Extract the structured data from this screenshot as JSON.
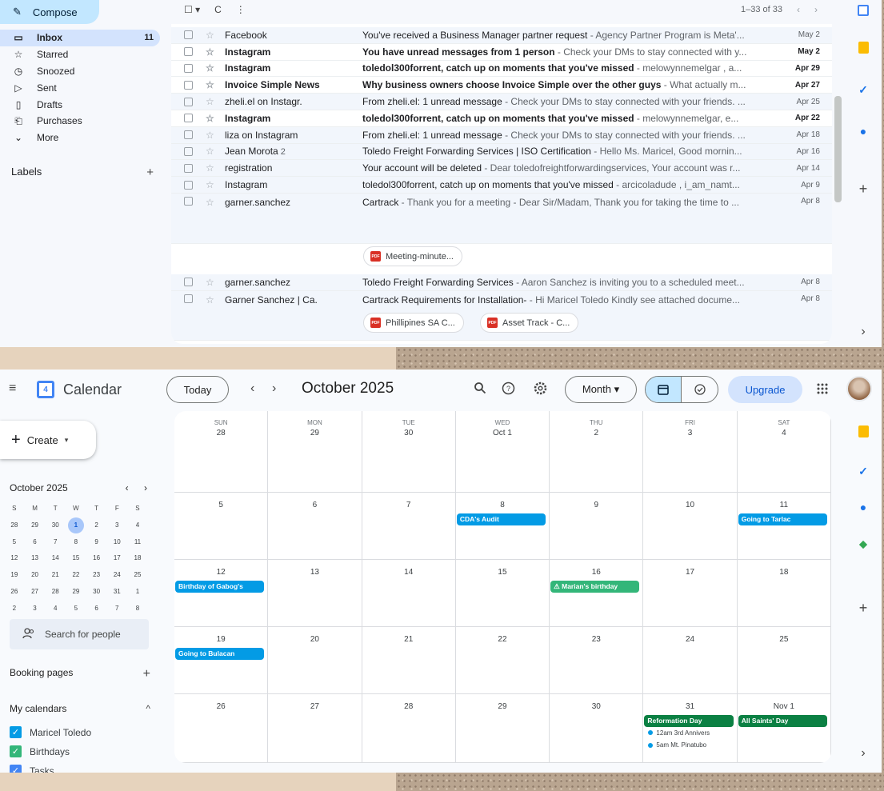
{
  "gmail": {
    "compose_label": "Compose",
    "nav": [
      {
        "icon": "inbox-icon",
        "glyph": "▭",
        "label": "Inbox",
        "count": "11",
        "active": true
      },
      {
        "icon": "star-icon",
        "glyph": "☆",
        "label": "Starred",
        "count": ""
      },
      {
        "icon": "clock-icon",
        "glyph": "◷",
        "label": "Snoozed",
        "count": ""
      },
      {
        "icon": "send-icon",
        "glyph": "▷",
        "label": "Sent",
        "count": ""
      },
      {
        "icon": "draft-icon",
        "glyph": "▯",
        "label": "Drafts",
        "count": ""
      },
      {
        "icon": "purchases-icon",
        "glyph": "⎗",
        "label": "Purchases",
        "count": ""
      },
      {
        "icon": "chevron-down-icon",
        "glyph": "⌄",
        "label": "More",
        "count": ""
      }
    ],
    "labels_title": "Labels",
    "labels_add": "+",
    "toolbar": {
      "select": "☐ ▾",
      "refresh": "C",
      "more": "⋮",
      "range": "1–33 of 33",
      "prev": "‹",
      "next": "›"
    },
    "emails": [
      {
        "sender": "Facebook",
        "num": "",
        "subject": "You've received a Business Manager partner request",
        "snippet": " - Agency Partner Program is Meta'...",
        "date": "May 2",
        "unread": false
      },
      {
        "sender": "Instagram",
        "num": "",
        "subject": "You have unread messages from 1 person",
        "snippet": " - Check your DMs to stay connected with y...",
        "date": "May 2",
        "unread": true
      },
      {
        "sender": "Instagram",
        "num": "",
        "subject": "toledol300forrent, catch up on moments that you've missed",
        "snippet": " - melowynnemelgar , a...",
        "date": "Apr 29",
        "unread": true
      },
      {
        "sender": "Invoice Simple News",
        "num": "",
        "subject": "Why business owners choose Invoice Simple over the other guys",
        "snippet": " - What actually m...",
        "date": "Apr 27",
        "unread": true
      },
      {
        "sender": "zheli.el on Instagr.",
        "num": "",
        "subject": "From zheli.el: 1 unread message",
        "snippet": " - Check your DMs to stay connected with your friends. ...",
        "date": "Apr 25",
        "unread": false
      },
      {
        "sender": "Instagram",
        "num": "",
        "subject": "toledol300forrent, catch up on moments that you've missed",
        "snippet": " - melowynnemelgar, e...",
        "date": "Apr 22",
        "unread": true
      },
      {
        "sender": "liza on Instagram",
        "num": "",
        "subject": "From zheli.el: 1 unread message",
        "snippet": " - Check your DMs to stay connected with your friends. ...",
        "date": "Apr 18",
        "unread": false
      },
      {
        "sender": "Jean Morota",
        "num": " 2",
        "subject": "Toledo Freight Forwarding Services | ISO Certification",
        "snippet": " - Hello Ms. Maricel, Good mornin...",
        "date": "Apr 16",
        "unread": false
      },
      {
        "sender": "registration",
        "num": "",
        "subject": "Your account will be deleted",
        "snippet": " - Dear toledofreightforwardingservices, Your account was r...",
        "date": "Apr 14",
        "unread": false
      },
      {
        "sender": "Instagram",
        "num": "",
        "subject": "toledol300forrent, catch up on moments that you've missed",
        "snippet": " - arcicoladude , i_am_namt...",
        "date": "Apr 9",
        "unread": false
      },
      {
        "sender": "garner.sanchez",
        "num": "",
        "subject": "Cartrack",
        "snippet": " - Thank you for a meeting - Dear Sir/Madam, Thank you for taking the time to ...",
        "date": "Apr 8",
        "unread": false
      },
      {
        "sender": "garner.sanchez",
        "num": "",
        "subject": "Toledo Freight Forwarding Services",
        "snippet": " - Aaron Sanchez is inviting you to a scheduled meet...",
        "date": "Apr 8",
        "unread": false
      },
      {
        "sender": "Garner Sanchez | Ca.",
        "num": "",
        "subject": "Cartrack Requirements for Installation-",
        "snippet": " - Hi Maricel Toledo Kindly see attached docume...",
        "date": "Apr 8",
        "unread": false
      }
    ],
    "attachments": {
      "meeting": "Meeting-minute...",
      "philippines": "Phillipines SA C...",
      "asset": "Asset Track - C..."
    },
    "pdf_badge": "PDF",
    "side_add": "+",
    "side_expand": "›"
  },
  "calendar": {
    "menu_glyph": "≡",
    "logo_day": "4",
    "app_title": "Calendar",
    "today_label": "Today",
    "prev": "‹",
    "next": "›",
    "month_title": "October 2025",
    "view_label": "Month ▾",
    "upgrade_label": "Upgrade",
    "apps_glyph": "⋮⋮⋮",
    "create_label": "Create",
    "mini": {
      "title": "October 2025",
      "prev": "‹",
      "next": "›",
      "dows": [
        "S",
        "M",
        "T",
        "W",
        "T",
        "F",
        "S"
      ],
      "weeks": [
        [
          "28",
          "29",
          "30",
          "1",
          "2",
          "3",
          "4"
        ],
        [
          "5",
          "6",
          "7",
          "8",
          "9",
          "10",
          "11"
        ],
        [
          "12",
          "13",
          "14",
          "15",
          "16",
          "17",
          "18"
        ],
        [
          "19",
          "20",
          "21",
          "22",
          "23",
          "24",
          "25"
        ],
        [
          "26",
          "27",
          "28",
          "29",
          "30",
          "31",
          "1"
        ],
        [
          "2",
          "3",
          "4",
          "5",
          "6",
          "7",
          "8"
        ]
      ],
      "today": "1"
    },
    "search_people": "Search for people",
    "booking_pages": "Booking pages",
    "booking_add": "+",
    "my_calendars": "My calendars",
    "my_calendars_toggle": "^",
    "calendars": [
      {
        "label": "Maricel Toledo",
        "color": "#039be5"
      },
      {
        "label": "Birthdays",
        "color": "#33b679"
      },
      {
        "label": "Tasks",
        "color": "#4285f4"
      }
    ],
    "dows": [
      "SUN",
      "MON",
      "TUE",
      "WED",
      "THU",
      "FRI",
      "SAT"
    ],
    "weeks": [
      [
        "28",
        "29",
        "30",
        "Oct 1",
        "2",
        "3",
        "4"
      ],
      [
        "5",
        "6",
        "7",
        "8",
        "9",
        "10",
        "11"
      ],
      [
        "12",
        "13",
        "14",
        "15",
        "16",
        "17",
        "18"
      ],
      [
        "19",
        "20",
        "21",
        "22",
        "23",
        "24",
        "25"
      ],
      [
        "26",
        "27",
        "28",
        "29",
        "30",
        "31",
        "Nov 1"
      ]
    ],
    "events": [
      {
        "week": 1,
        "day": 3,
        "slot": 0,
        "label": "CDA's Audit",
        "color": "#039be5"
      },
      {
        "week": 1,
        "day": 6,
        "slot": 0,
        "label": "Going to Tarlac",
        "color": "#039be5"
      },
      {
        "week": 2,
        "day": 0,
        "slot": 0,
        "label": "Birthday of Gabog's",
        "color": "#039be5"
      },
      {
        "week": 2,
        "day": 4,
        "slot": 0,
        "label": "⚠ Marian's birthday",
        "color": "#33b679"
      },
      {
        "week": 3,
        "day": 0,
        "slot": 0,
        "label": "Going to Bulacan",
        "color": "#039be5"
      },
      {
        "week": 4,
        "day": 5,
        "slot": 0,
        "label": "Reformation Day",
        "color": "#0b8043"
      },
      {
        "week": 4,
        "day": 6,
        "slot": 0,
        "label": "All Saints' Day",
        "color": "#0b8043"
      }
    ],
    "dot_events": [
      {
        "week": 4,
        "day": 5,
        "slot": 1,
        "label": "12am 3rd Annivers"
      },
      {
        "week": 4,
        "day": 5,
        "slot": 2,
        "label": "5am Mt. Pinatubo"
      }
    ],
    "side_add": "+",
    "side_expand": "›"
  }
}
